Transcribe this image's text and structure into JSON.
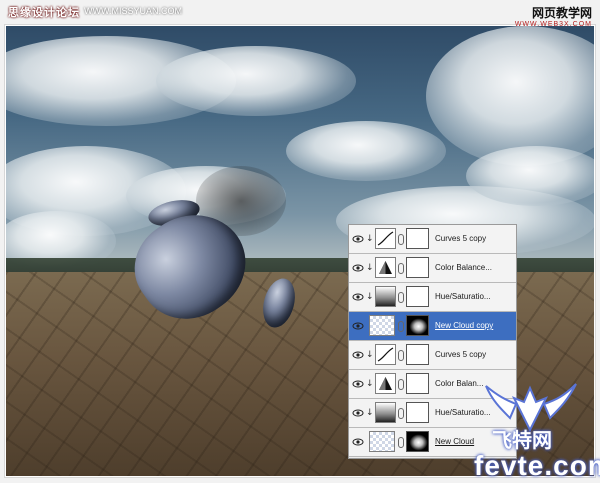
{
  "watermarks": {
    "top_left_cn": "思缘设计论坛",
    "top_left_url": "WWW.MISSYUAN.COM",
    "top_right_cn": "网页教学网",
    "top_right_en": "WWW.WEB3X.COM",
    "bottom_right_cn": "飞特网",
    "bottom_right_en": "fevte.com"
  },
  "layers_panel": {
    "layers": [
      {
        "name": "Curves 5 copy",
        "type": "adjustment",
        "adjustment_icon": "curves-icon",
        "clipped": true,
        "visible": true,
        "selected": false
      },
      {
        "name": "Color Balance...",
        "type": "adjustment",
        "adjustment_icon": "color-balance-icon",
        "clipped": true,
        "visible": true,
        "selected": false
      },
      {
        "name": "Hue/Saturatio...",
        "type": "adjustment",
        "adjustment_icon": "hue-saturation-icon",
        "clipped": true,
        "visible": true,
        "selected": false
      },
      {
        "name": "New Cloud copy",
        "type": "image",
        "mask": "cloud",
        "clipped": false,
        "visible": true,
        "selected": true
      },
      {
        "name": "Curves 5 copy",
        "type": "adjustment",
        "adjustment_icon": "curves-icon",
        "clipped": true,
        "visible": true,
        "selected": false
      },
      {
        "name": "Color Balan...",
        "type": "adjustment",
        "adjustment_icon": "color-balance-icon",
        "clipped": true,
        "visible": true,
        "selected": false
      },
      {
        "name": "Hue/Saturatio...",
        "type": "adjustment",
        "adjustment_icon": "hue-saturation-icon",
        "clipped": true,
        "visible": true,
        "selected": false
      },
      {
        "name": "New Cloud",
        "type": "image",
        "mask": "cloud",
        "clipped": false,
        "visible": true,
        "selected": false
      }
    ]
  },
  "colors": {
    "selection": "#3d6ec0",
    "panel_bg": "#ececec"
  }
}
